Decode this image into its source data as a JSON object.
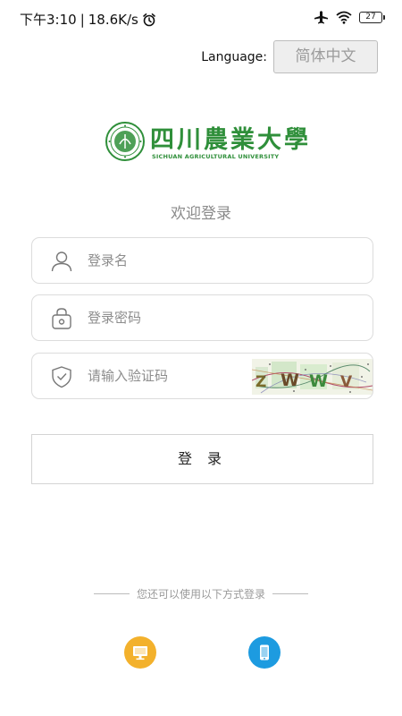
{
  "status_bar": {
    "time": "下午3:10",
    "separator": "|",
    "speed": "18.6K/s",
    "battery": "27",
    "icons": [
      "alarm-icon",
      "airplane-icon",
      "wifi-icon",
      "battery-icon"
    ]
  },
  "language": {
    "label": "Language:",
    "selected": "简体中文"
  },
  "logo": {
    "chinese_name": "四川農業大學",
    "english_name": "SICHUAN AGRICULTURAL UNIVERSITY"
  },
  "welcome": "欢迎登录",
  "form": {
    "username_placeholder": "登录名",
    "password_placeholder": "登录密码",
    "captcha_placeholder": "请输入验证码",
    "captcha_text": "ZWWV",
    "login_button": "登 录"
  },
  "alternate": {
    "label": "您还可以使用以下方式登录",
    "options": [
      "pc-login-icon",
      "mobile-login-icon"
    ]
  },
  "colors": {
    "brand_green": "#2f8f3a",
    "pc_option": "#f3b12c",
    "mobile_option": "#1d9be0"
  }
}
